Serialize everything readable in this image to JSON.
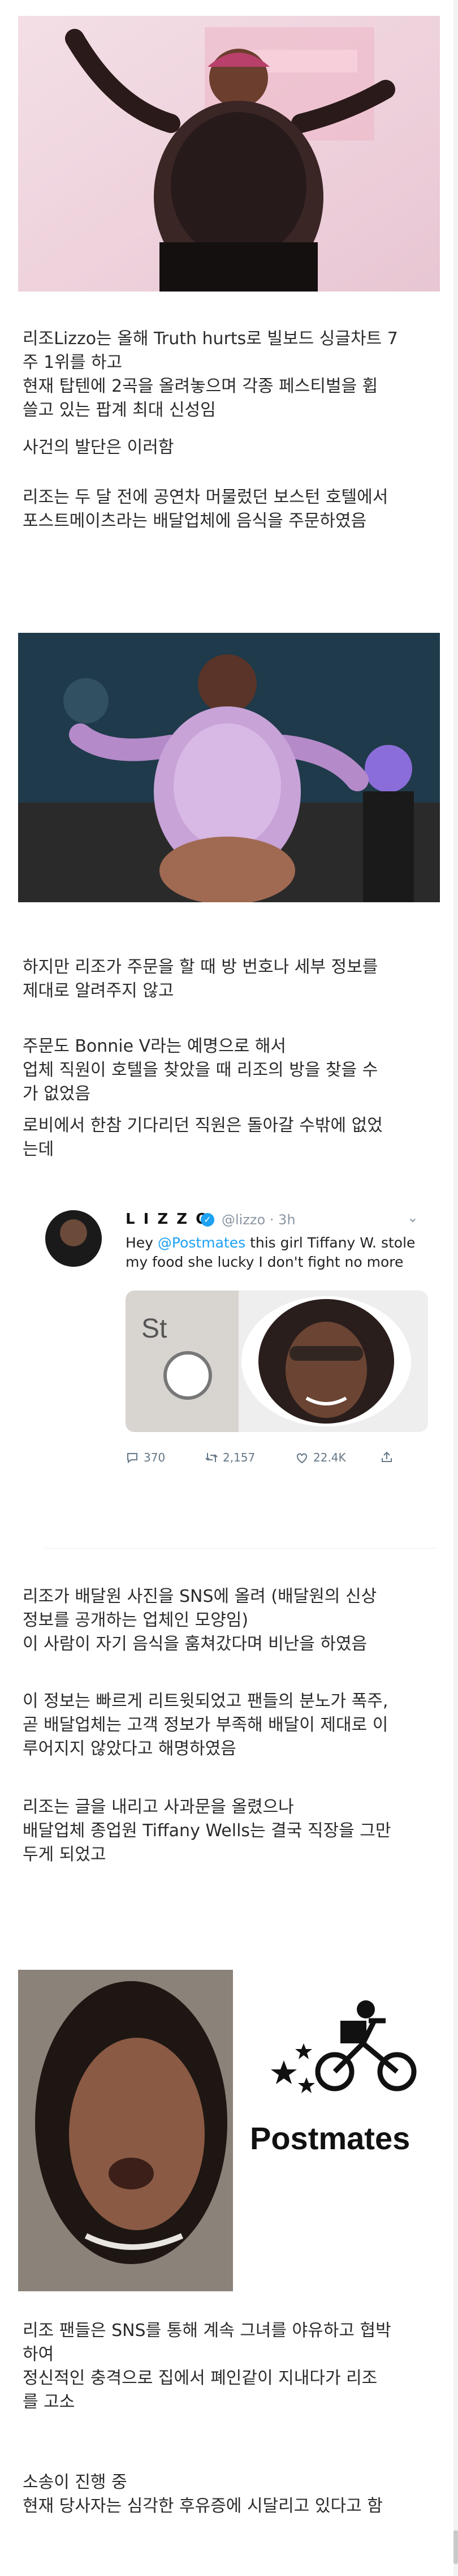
{
  "article": {
    "p1": "리조Lizzo는 올해 Truth hurts로 빌보드 싱글차트 7\n주 1위를 하고\n현재 탑텐에 2곡을 올려놓으며 각종 페스티벌을 휩\n쓸고 있는 팝계 최대 신성임",
    "p2": "사건의 발단은 이러함",
    "p3": "리조는 두 달 전에 공연차 머물렀던 보스턴 호텔에서\n포스트메이츠라는 배달업체에 음식을 주문하였음",
    "p4": "하지만 리조가 주문을 할 때 방 번호나 세부 정보를\n제대로 알려주지 않고",
    "p5": "주문도 Bonnie V라는 예명으로 해서\n업체 직원이 호텔을 찾았을 때 리조의 방을 찾을 수\n가 없었음",
    "p6": "로비에서 한참 기다리던 직원은 돌아갈 수밖에 없었\n는데",
    "p7": "리조가 배달원 사진을 SNS에 올려 (배달원의 신상\n정보를 공개하는 업체인 모양임)\n이 사람이 자기 음식을 훔쳐갔다며 비난을 하였음",
    "p8": "이 정보는 빠르게 리트윗되었고 팬들의 분노가 폭주,\n곧 배달업체는 고객 정보가 부족해 배달이 제대로 이\n루어지지 않았다고 해명하였음",
    "p9": "리조는 글을 내리고 사과문을 올렸으나\n배달업체 종업원 Tiffany Wells는 결국 직장을 그만\n두게 되었고",
    "p10": "리조 팬들은 SNS를 통해 계속 그녀를 야유하고 협박\n하여\n정신적인 충격으로 집에서 폐인같이 지내다가 리조\n를 고소",
    "p11": "소송이 진행 중\n현재 당사자는 심각한 후유증에 시달리고 있다고 함"
  },
  "tweet": {
    "name": "L I Z Z O",
    "handle": "@lizzo · 3h",
    "text_pre": "Hey ",
    "mention": "@Postmates",
    "text_post": " this girl Tiffany W. stole my food she lucky I don't fight no more",
    "media_sign": "St",
    "replies": "370",
    "retweets": "2,157",
    "likes": "22.4K"
  },
  "images": {
    "photo3_logo": "Postmates"
  },
  "colors": {
    "twitter_blue": "#1da1f2",
    "muted": "#657786"
  }
}
